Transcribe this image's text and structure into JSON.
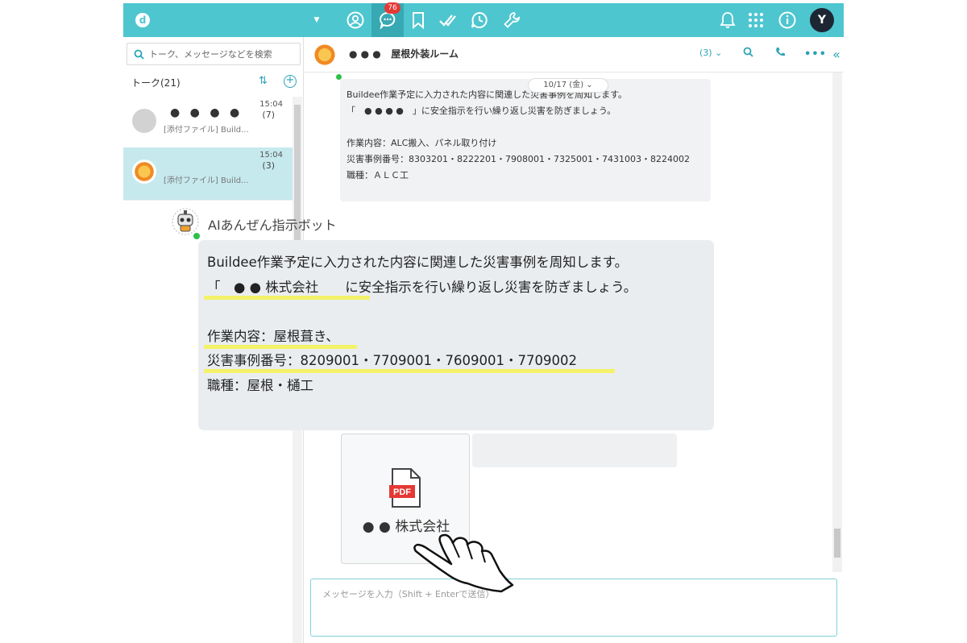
{
  "topbar": {
    "logo_letter": "d",
    "notification_count": "76",
    "avatar_text": "Y"
  },
  "left_panel": {
    "search_placeholder": "トーク、メッセージなどを検索",
    "talk_count_label": "トーク(21)",
    "talks": [
      {
        "name": "● ● ● ●",
        "time": "15:04",
        "count": "(7)",
        "preview": "[添付ファイル] Build..."
      },
      {
        "name": "",
        "time": "15:04",
        "count": "(3)",
        "preview": "[添付ファイル] Build..."
      }
    ]
  },
  "chat_header": {
    "room_title": "● ● ●   屋根外装ルーム",
    "member_count": "(3)"
  },
  "chat": {
    "date_label": "10/17 (金)",
    "small_message_lines": [
      "Buildee作業予定に入力された内容に関連した災害事例を周知します。",
      "「　● ● ● ●　」に安全指示を行い繰り返し災害を防ぎましょう。",
      "",
      "作業内容：ALC搬入、パネル取り付け",
      "災害事例番号：8303201・8222201・7908001・7325001・7431003・8224002",
      "職種：ＡＬＣ工"
    ],
    "file_card": {
      "file_name": "● ●  株式会社",
      "file_type": "PDF"
    },
    "composer_placeholder": "メッセージを入力（Shift + Enterで送信）"
  },
  "zoom": {
    "sender_name": "AIあんぜん指示ボット",
    "message_lines": [
      "Buildee作業予定に入力された内容に関連した災害事例を周知します。",
      "「　● ● 株式会社　　に安全指示を行い繰り返し災害を防ぎましょう。",
      "",
      "作業内容：屋根葺き、",
      "災害事例番号：8209001・7709001・7609001・7709002",
      "職種：屋根・樋工"
    ]
  },
  "colors": {
    "brand": "#4ec6cf",
    "accent": "#2ba3b8",
    "highlight": "#f5f25a",
    "badge": "#e53935",
    "online": "#2ec14a"
  }
}
